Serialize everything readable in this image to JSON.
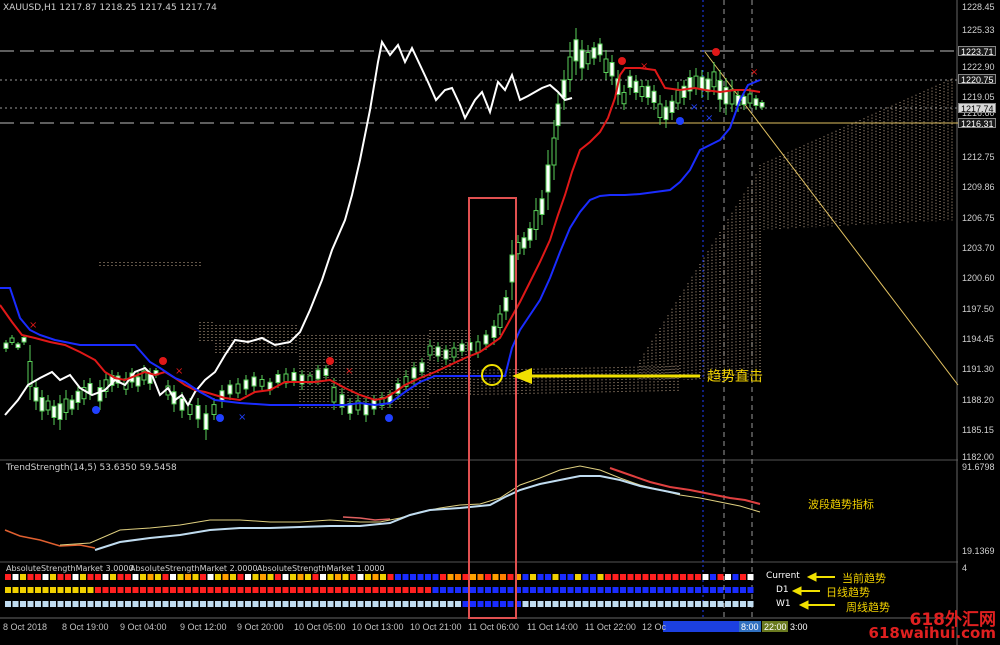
{
  "symbol_header": "XAUUSD,H1  1217.87 1218.25 1217.45 1217.74",
  "indicator_header": "TrendStrength(14,5) 53.6350 59.5458",
  "asm_header": {
    "a": "AbsoluteStrengthMarket 3.0000",
    "b": "AbsoluteStrengthMarket 2.0000",
    "c": "AbsoluteStrengthMarket 1.0000"
  },
  "price_axis": [
    "1228.45",
    "1225.33",
    "1222.90",
    "1219.05",
    "1216.60",
    "1212.75",
    "1209.86",
    "1206.75",
    "1203.70",
    "1200.60",
    "1197.50",
    "1194.45",
    "1191.30",
    "1188.20",
    "1185.15",
    "1182.00"
  ],
  "price_tags": [
    "1223.71",
    "1220.75",
    "1217.74",
    "1216.31"
  ],
  "indicator_axis": {
    "top": "91.6798",
    "bottom": "19.1369"
  },
  "asm_axis": "4",
  "time_axis": [
    "8 Oct 2018",
    "8 Oct 19:00",
    "9 Oct 04:00",
    "9 Oct 12:00",
    "9 Oct 20:00",
    "10 Oct 05:00",
    "10 Oct 13:00",
    "10 Oct 21:00",
    "11 Oct 06:00",
    "11 Oct 14:00",
    "11 Oct 22:00",
    "12 Oc",
    "8:00",
    "22:00",
    "3:00"
  ],
  "annotations": {
    "trend_hit": "趋势直击",
    "wave_indicator": "波段趋势指标",
    "current": "Current",
    "current_cn": "当前趋势",
    "d1": "D1",
    "d1_cn": "日线趋势",
    "w1": "W1",
    "w1_cn": "周线趋势"
  },
  "watermark": {
    "line1": "618外汇网",
    "line2": "618waihui.com"
  },
  "colors": {
    "bull": "#66dd66",
    "bear": "#66dd66",
    "red": "#e02020",
    "blue": "#2030ff",
    "white": "#ffffff",
    "yellow": "#f0e000",
    "cloud": "#f0c8a0"
  }
}
